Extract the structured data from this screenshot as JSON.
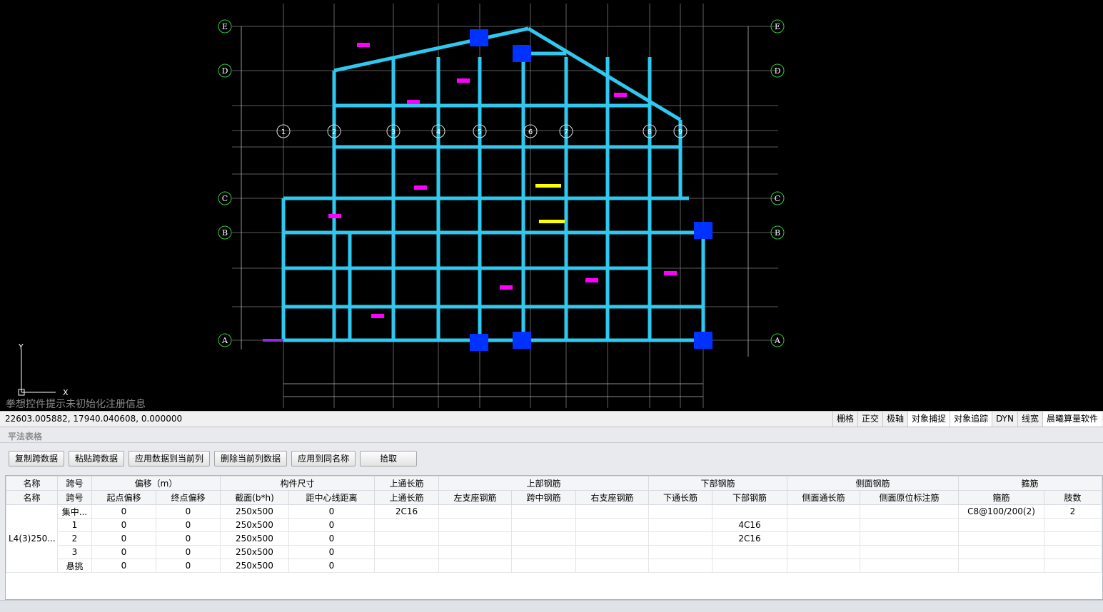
{
  "cad": {
    "axes_left": [
      "E",
      "D",
      "C",
      "B",
      "A"
    ],
    "axes_right": [
      "E",
      "D",
      "C",
      "B",
      "A"
    ],
    "axes_top": [
      "1",
      "2",
      "3",
      "4",
      "5",
      "6",
      "7",
      "8",
      "9"
    ],
    "registration_notice": "拳想控件提示未初始化注册信息",
    "ucs_x": "X",
    "ucs_y": "Y",
    "colors": {
      "beam": "#2ec8f0",
      "column": "#0032ff",
      "grid": "#7a7a7a",
      "axis": "#2ecc40",
      "magenta": "#ff00ff",
      "yellow": "#ffff00"
    }
  },
  "status": {
    "coordinates": "22603.005882,  17940.040608,  0.000000",
    "toggles": [
      "栅格",
      "正交",
      "极轴",
      "对象捕捉",
      "对象追踪",
      "DYN",
      "线宽",
      "晨曦算量软件"
    ]
  },
  "panel": {
    "title": "平法表格",
    "buttons": [
      "复制跨数据",
      "粘贴跨数据",
      "应用数据到当前列",
      "删除当前列数据",
      "应用到同名称",
      "拾取"
    ]
  },
  "table": {
    "groups": [
      {
        "label": "名称",
        "span": 1
      },
      {
        "label": "跨号",
        "span": 1
      },
      {
        "label": "偏移（m）",
        "span": 2
      },
      {
        "label": "构件尺寸",
        "span": 2
      },
      {
        "label": "上通长筋",
        "span": 1
      },
      {
        "label": "上部钢筋",
        "span": 3
      },
      {
        "label": "下部钢筋",
        "span": 2
      },
      {
        "label": "侧面钢筋",
        "span": 2
      },
      {
        "label": "箍筋",
        "span": 2
      }
    ],
    "columns": [
      "名称",
      "跨号",
      "起点偏移",
      "终点偏移",
      "截面(b*h)",
      "距中心线距离",
      "上通长筋",
      "左支座钢筋",
      "跨中钢筋",
      "右支座钢筋",
      "下通长筋",
      "下部钢筋",
      "侧面通长筋",
      "侧面原位标注筋",
      "箍筋",
      "肢数"
    ],
    "name_value": "L4(3)250...",
    "rows": [
      [
        "集中...",
        "0",
        "0",
        "250x500",
        "0",
        "2C16",
        "",
        "",
        "",
        "",
        "",
        "",
        "",
        "C8@100/200(2)",
        "2"
      ],
      [
        "1",
        "0",
        "0",
        "250x500",
        "0",
        "",
        "",
        "",
        "",
        "",
        "4C16",
        "",
        "",
        "",
        ""
      ],
      [
        "2",
        "0",
        "0",
        "250x500",
        "0",
        "",
        "",
        "",
        "",
        "",
        "2C16",
        "",
        "",
        "",
        ""
      ],
      [
        "3",
        "0",
        "0",
        "250x500",
        "0",
        "",
        "",
        "",
        "",
        "",
        "",
        "",
        "",
        "",
        ""
      ],
      [
        "悬挑",
        "0",
        "0",
        "250x500",
        "0",
        "",
        "",
        "",
        "",
        "",
        "",
        "",
        "",
        "",
        ""
      ]
    ]
  }
}
